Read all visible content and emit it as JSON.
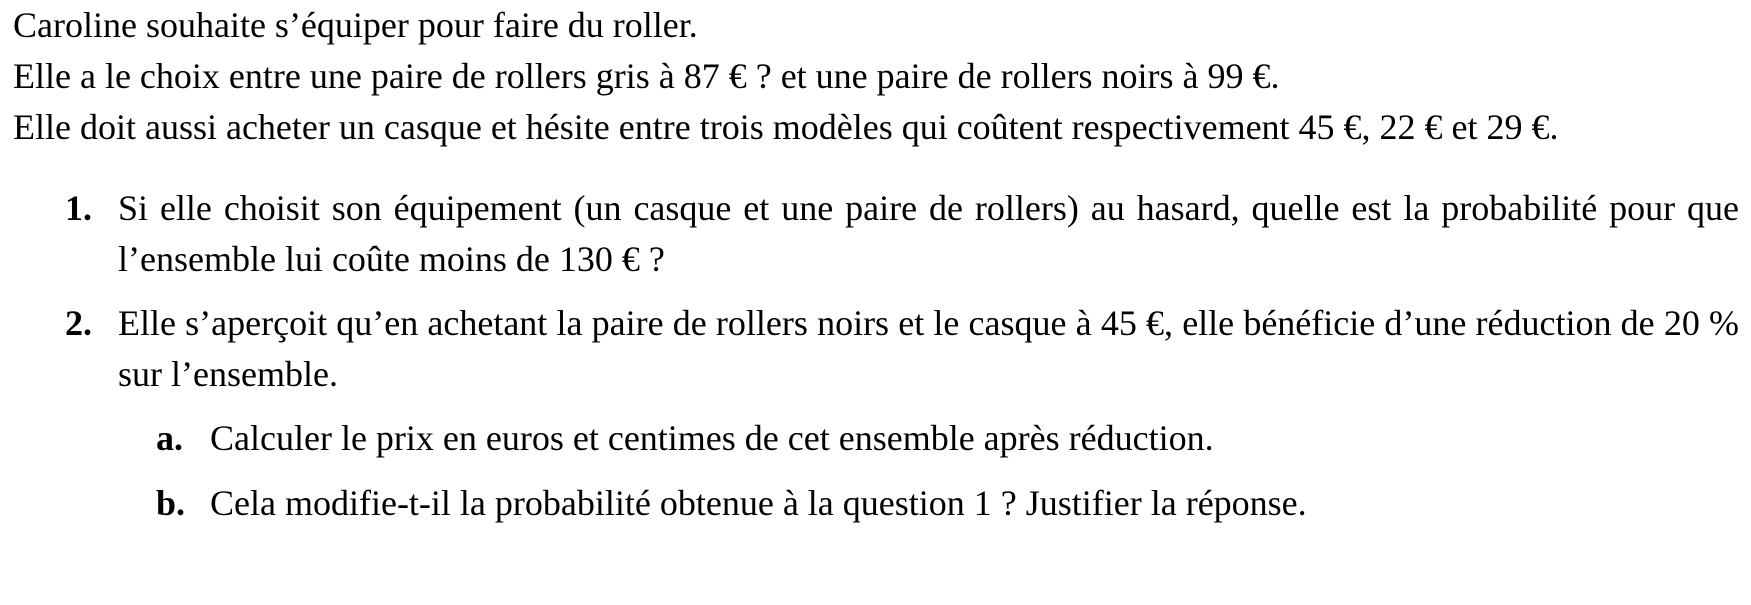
{
  "intro": {
    "line1": "Caroline souhaite s’équiper pour faire du roller.",
    "line2": "Elle a le choix entre une paire de rollers gris à 87 € ? et une paire de rollers noirs à 99 €.",
    "line3": "Elle doit aussi acheter un casque et hésite entre trois modèles qui coûtent respectivement 45 €, 22 € et 29 €."
  },
  "questions": [
    {
      "number": "1.",
      "text": "Si elle choisit son équipement (un casque et une paire de rollers) au hasard, quelle est la probabilité pour que l’ensemble lui coûte moins de 130 € ?"
    },
    {
      "number": "2.",
      "text": "Elle s’aperçoit qu’en achetant la paire de rollers noirs et le casque à 45 €, elle bénéficie d’une réduction de 20 % sur l’ensemble.",
      "subquestions": [
        {
          "letter": "a.",
          "text": "Calculer le prix en euros et centimes de cet ensemble après réduction."
        },
        {
          "letter": "b.",
          "text": "Cela modifie-t-il la probabilité obtenue à la question 1 ? Justifier la réponse."
        }
      ]
    }
  ]
}
